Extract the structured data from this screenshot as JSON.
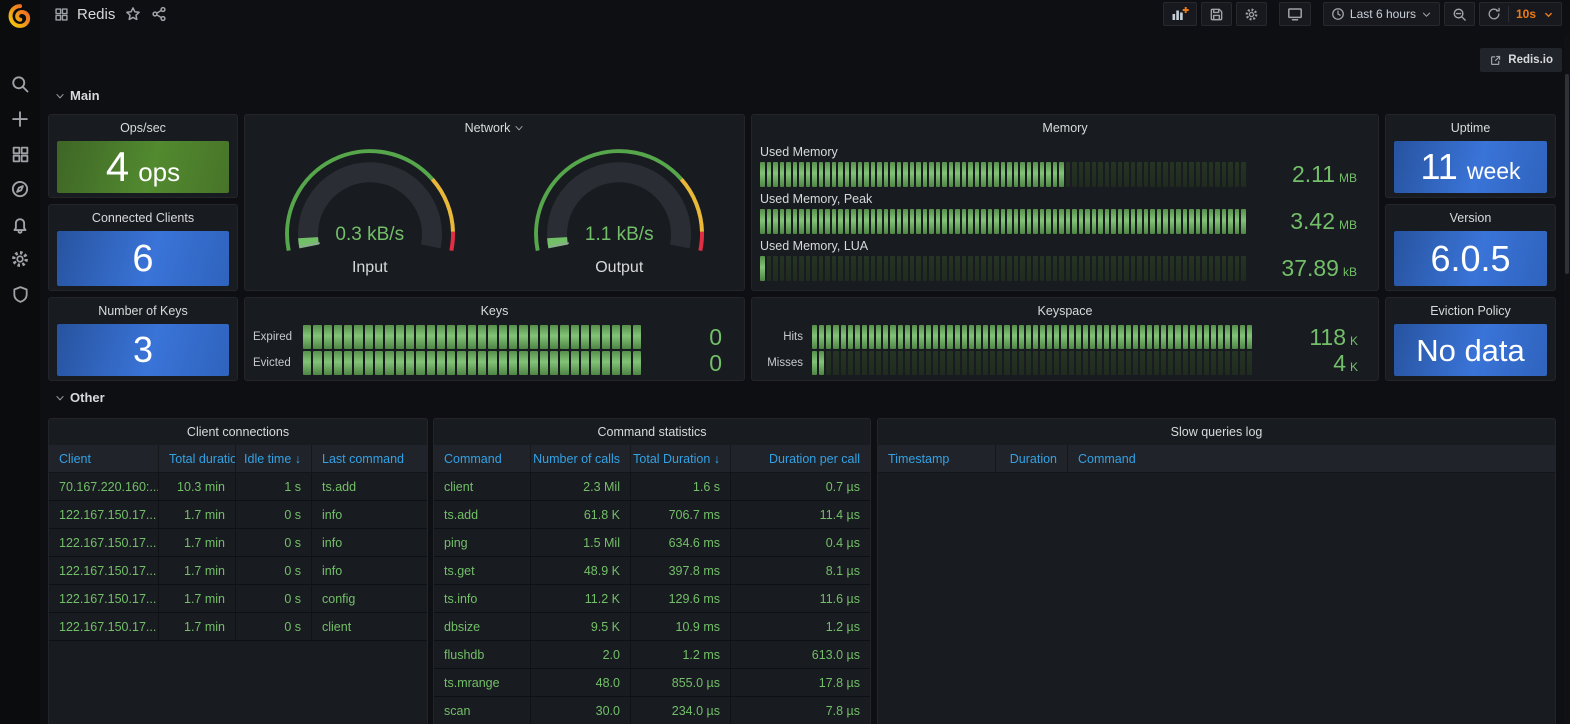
{
  "app": {
    "title": "Redis",
    "time_range": "Last 6 hours",
    "refresh_interval": "10s",
    "external_link": "Redis.io"
  },
  "sections": {
    "main": "Main",
    "other": "Other"
  },
  "stats": {
    "ops": {
      "title": "Ops/sec",
      "value": "4",
      "unit": "ops",
      "bg": "green"
    },
    "clients": {
      "title": "Connected Clients",
      "value": "6",
      "bg": "blue"
    },
    "uptime": {
      "title": "Uptime",
      "value": "11",
      "unit": "week",
      "bg": "blue"
    },
    "version": {
      "title": "Version",
      "value": "6.0.5",
      "bg": "blue"
    },
    "numkeys": {
      "title": "Number of Keys",
      "value": "3",
      "bg": "blue"
    },
    "eviction": {
      "title": "Eviction Policy",
      "value": "No data",
      "bg": "blue"
    }
  },
  "network": {
    "title": "Network",
    "items": [
      {
        "label": "Input",
        "value": "0.3 kB/s"
      },
      {
        "label": "Output",
        "value": "1.1 kB/s"
      }
    ]
  },
  "memory": {
    "title": "Memory",
    "rows": [
      {
        "label": "Used Memory",
        "value": "2.11",
        "unit": "MB",
        "fill": 0.62
      },
      {
        "label": "Used Memory, Peak",
        "value": "3.42",
        "unit": "MB",
        "fill": 1
      },
      {
        "label": "Used Memory, LUA",
        "value": "37.89",
        "unit": "kB",
        "fill": 0.013
      }
    ]
  },
  "keys_panel": {
    "title": "Keys",
    "rows": [
      {
        "label": "Expired",
        "value": "0",
        "unit": "",
        "fill": 1
      },
      {
        "label": "Evicted",
        "value": "0",
        "unit": "",
        "fill": 1
      }
    ]
  },
  "keyspace": {
    "title": "Keyspace",
    "rows": [
      {
        "label": "Hits",
        "value": "118",
        "unit": "K",
        "fill": 1
      },
      {
        "label": "Misses",
        "value": "4",
        "unit": "K",
        "fill": 0.032
      }
    ]
  },
  "tables": {
    "clients": {
      "title": "Client connections",
      "columns": [
        {
          "label": "Client",
          "align": "l"
        },
        {
          "label": "Total duration",
          "align": "r",
          "header_align": "l"
        },
        {
          "label": "Idle time",
          "align": "r",
          "sort": "desc"
        },
        {
          "label": "Last command",
          "align": "l"
        }
      ],
      "rows": [
        [
          "70.167.220.160:...",
          "10.3 min",
          "1 s",
          "ts.add"
        ],
        [
          "122.167.150.17...",
          "1.7 min",
          "0 s",
          "info"
        ],
        [
          "122.167.150.17...",
          "1.7 min",
          "0 s",
          "info"
        ],
        [
          "122.167.150.17...",
          "1.7 min",
          "0 s",
          "info"
        ],
        [
          "122.167.150.17...",
          "1.7 min",
          "0 s",
          "config"
        ],
        [
          "122.167.150.17...",
          "1.7 min",
          "0 s",
          "client"
        ]
      ]
    },
    "commands": {
      "title": "Command statistics",
      "columns": [
        {
          "label": "Command",
          "align": "l"
        },
        {
          "label": "Number of calls",
          "align": "r"
        },
        {
          "label": "Total Duration",
          "align": "r",
          "sort": "desc"
        },
        {
          "label": "Duration per call",
          "align": "r"
        }
      ],
      "rows": [
        [
          "client",
          "2.3 Mil",
          "1.6 s",
          "0.7 µs"
        ],
        [
          "ts.add",
          "61.8 K",
          "706.7 ms",
          "11.4 µs"
        ],
        [
          "ping",
          "1.5 Mil",
          "634.6 ms",
          "0.4 µs"
        ],
        [
          "ts.get",
          "48.9 K",
          "397.8 ms",
          "8.1 µs"
        ],
        [
          "ts.info",
          "11.2 K",
          "129.6 ms",
          "11.6 µs"
        ],
        [
          "dbsize",
          "9.5 K",
          "10.9 ms",
          "1.2 µs"
        ],
        [
          "flushdb",
          "2.0",
          "1.2 ms",
          "613.0 µs"
        ],
        [
          "ts.mrange",
          "48.0",
          "855.0 µs",
          "17.8 µs"
        ],
        [
          "scan",
          "30.0",
          "234.0 µs",
          "7.8 µs"
        ]
      ]
    },
    "slowlog": {
      "title": "Slow queries log",
      "columns": [
        {
          "label": "Timestamp",
          "align": "l"
        },
        {
          "label": "Duration",
          "align": "r"
        },
        {
          "label": "Command",
          "align": "l"
        }
      ],
      "rows": []
    }
  }
}
